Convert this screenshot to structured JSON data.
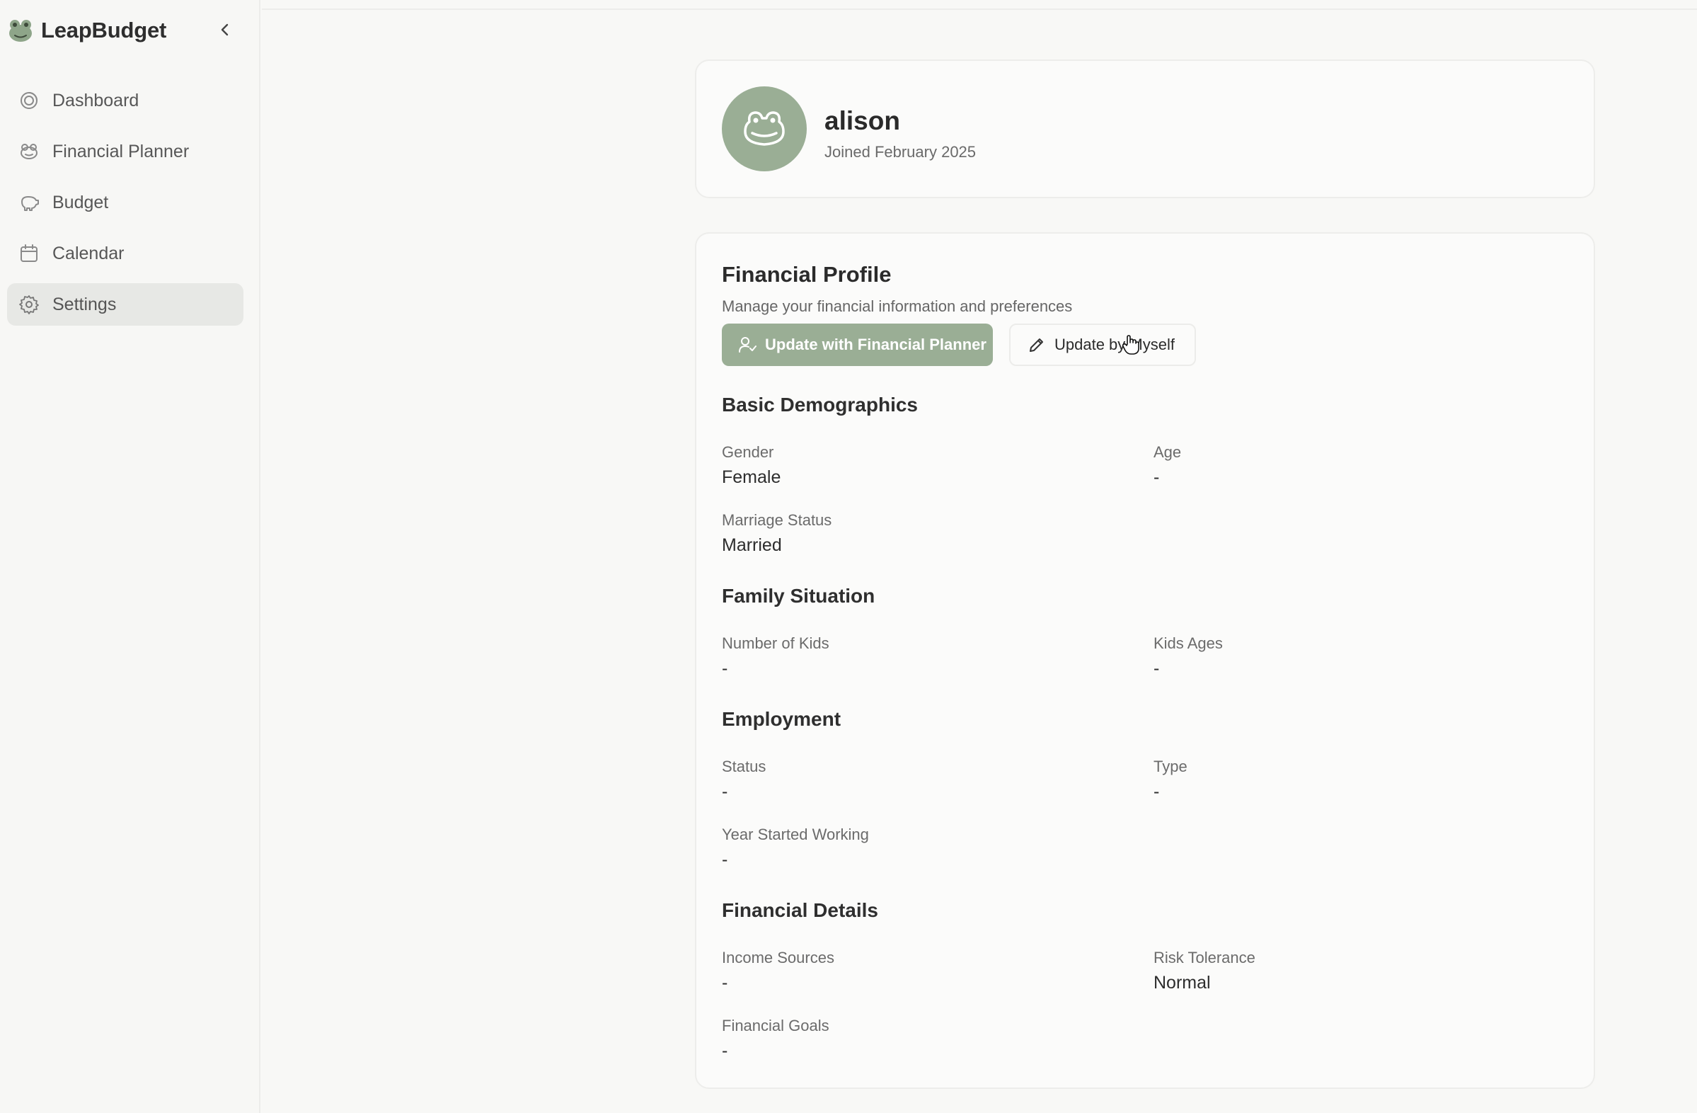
{
  "app": {
    "name": "LeapBudget",
    "brand_color": "#9aae95"
  },
  "sidebar": {
    "collapse_icon": "chevron-left-icon",
    "items": [
      {
        "label": "Dashboard",
        "icon": "dashboard-icon",
        "active": false
      },
      {
        "label": "Financial Planner",
        "icon": "planner-icon",
        "active": false
      },
      {
        "label": "Budget",
        "icon": "piggy-bank-icon",
        "active": false
      },
      {
        "label": "Calendar",
        "icon": "calendar-icon",
        "active": false
      },
      {
        "label": "Settings",
        "icon": "gear-icon",
        "active": true
      }
    ]
  },
  "profile": {
    "name": "alison",
    "joined": "Joined February 2025",
    "avatar_icon": "frog-avatar-icon"
  },
  "financial_profile": {
    "title": "Financial Profile",
    "subtitle": "Manage your financial information and preferences",
    "btn_planner": "Update with Financial Planner",
    "btn_self": "Update by Myself",
    "sections": [
      {
        "title": "Basic Demographics",
        "fields": [
          {
            "label": "Gender",
            "value": "Female"
          },
          {
            "label": "Age",
            "value": "-"
          },
          {
            "label": "Marriage Status",
            "value": "Married"
          }
        ]
      },
      {
        "title": "Family Situation",
        "fields": [
          {
            "label": "Number of Kids",
            "value": "-"
          },
          {
            "label": "Kids Ages",
            "value": "-"
          }
        ]
      },
      {
        "title": "Employment",
        "fields": [
          {
            "label": "Status",
            "value": "-"
          },
          {
            "label": "Type",
            "value": "-"
          },
          {
            "label": "Year Started Working",
            "value": "-"
          }
        ]
      },
      {
        "title": "Financial Details",
        "fields": [
          {
            "label": "Income Sources",
            "value": "-"
          },
          {
            "label": "Risk Tolerance",
            "value": "Normal"
          },
          {
            "label": "Financial Goals",
            "value": "-"
          }
        ]
      }
    ]
  }
}
